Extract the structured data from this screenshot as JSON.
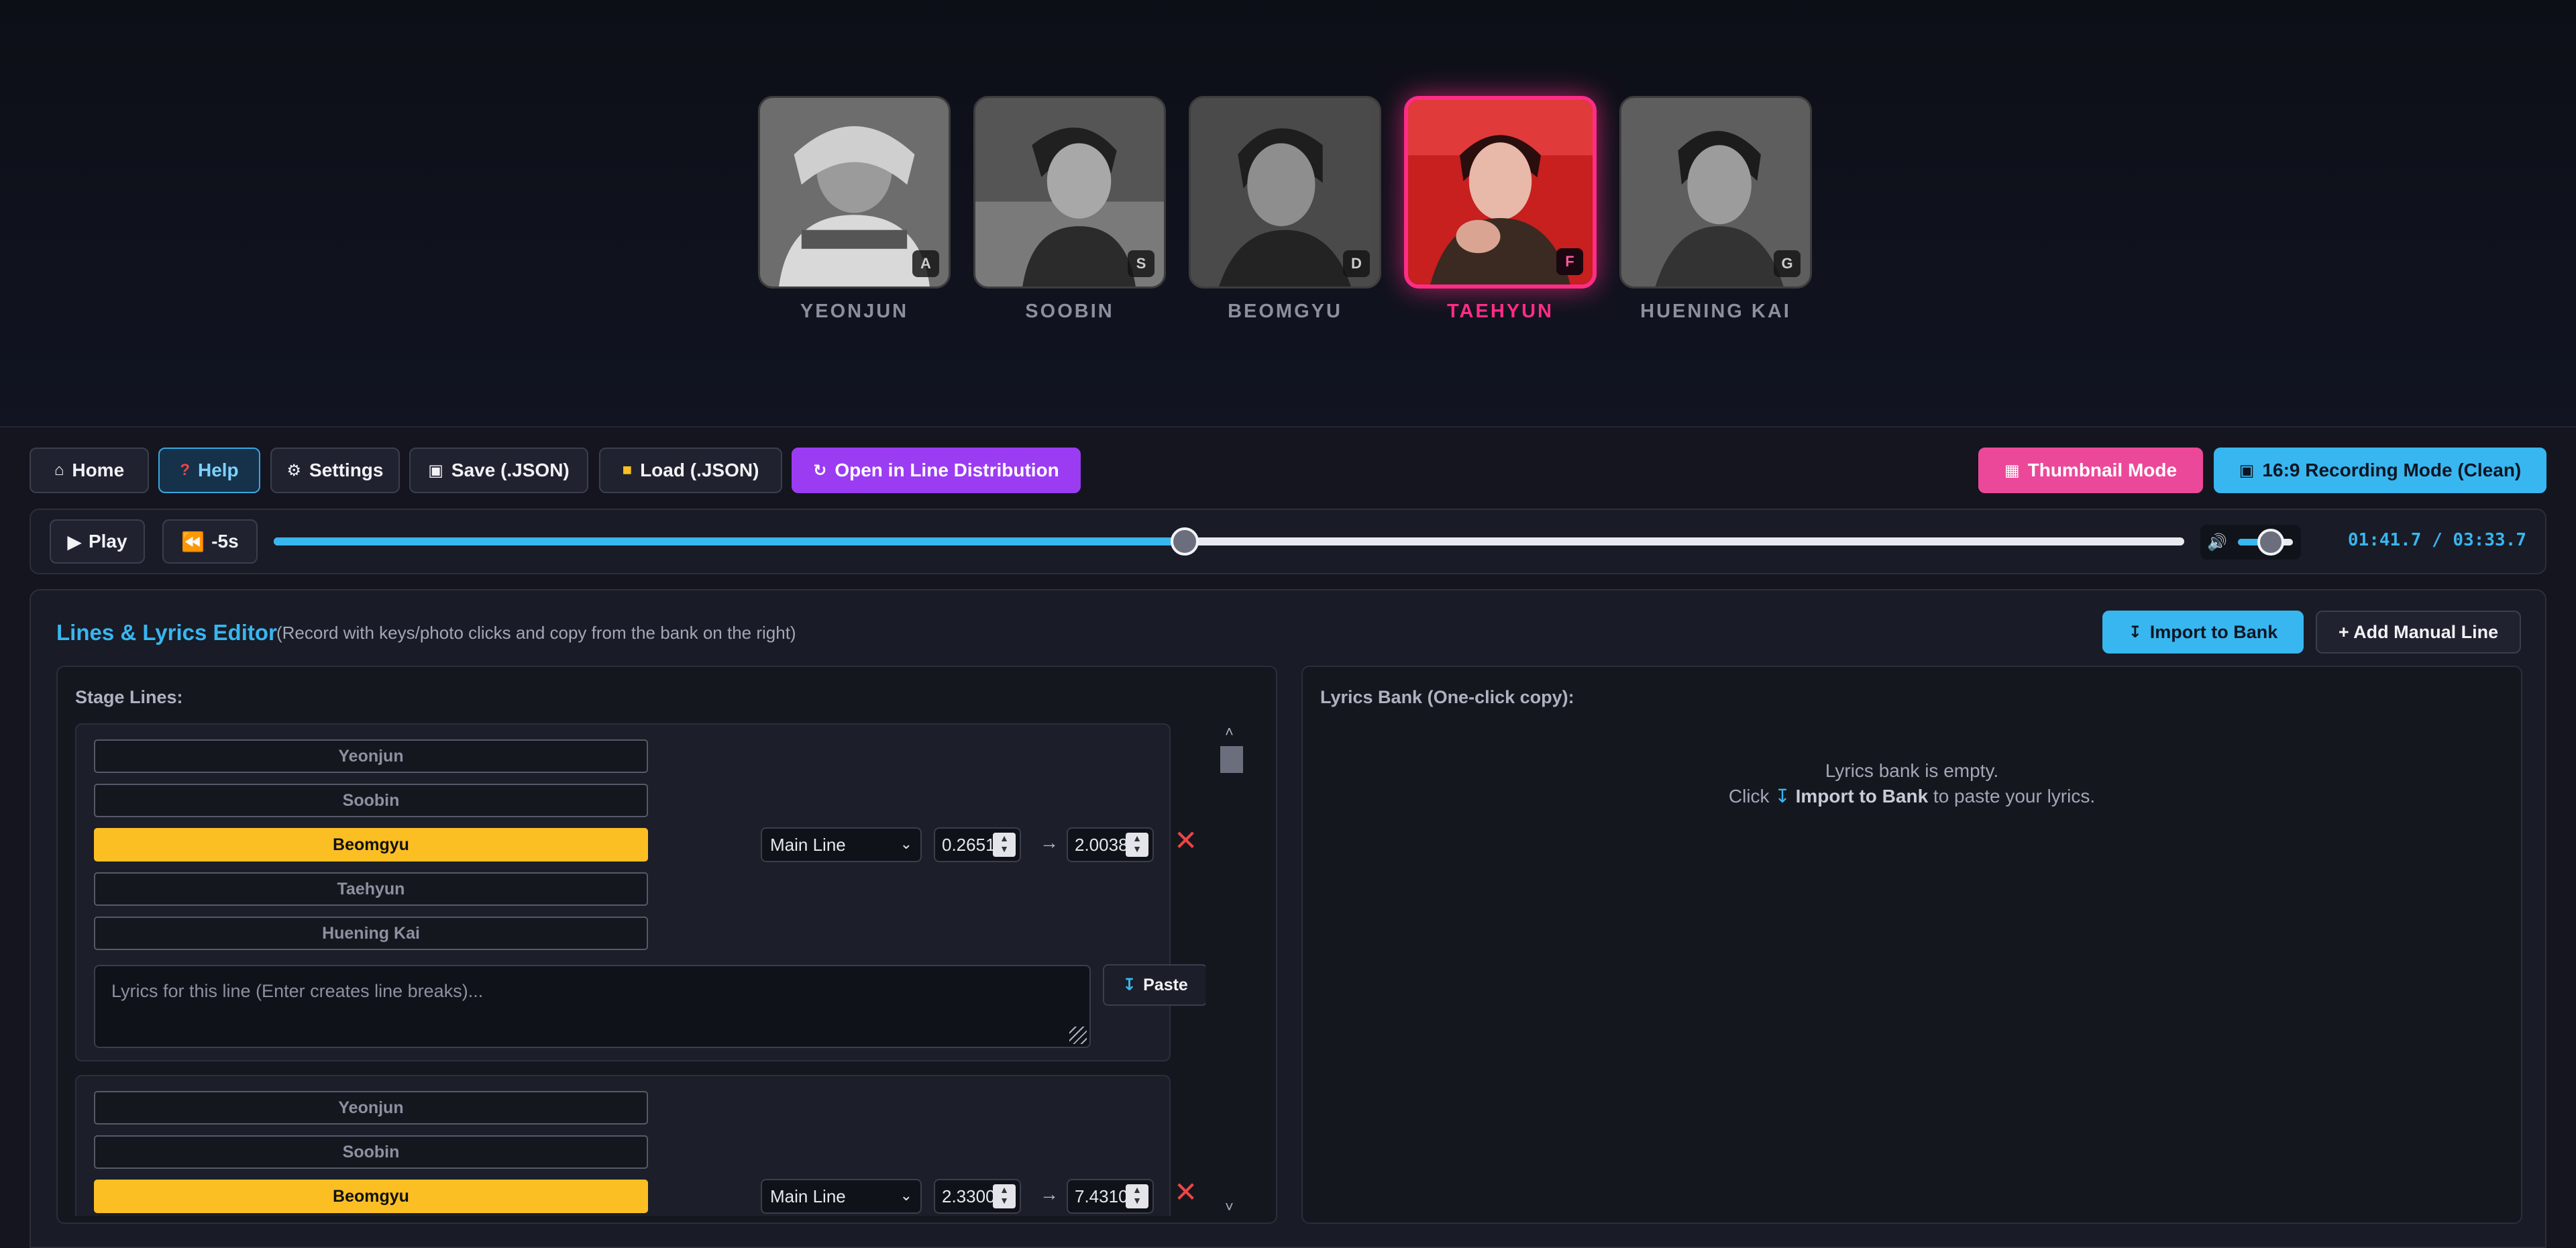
{
  "members": [
    {
      "name": "YEONJUN",
      "key": "A",
      "active": false
    },
    {
      "name": "SOOBIN",
      "key": "S",
      "active": false
    },
    {
      "name": "BEOMGYU",
      "key": "D",
      "active": false
    },
    {
      "name": "TAEHYUN",
      "key": "F",
      "active": true
    },
    {
      "name": "HUENING KAI",
      "key": "G",
      "active": false
    }
  ],
  "toolbar": {
    "home": "Home",
    "help": "Help",
    "settings": "Settings",
    "save": "Save (.JSON)",
    "load": "Load (.JSON)",
    "open_line_distribution": "Open in Line Distribution",
    "thumbnail_mode": "Thumbnail Mode",
    "recording_mode": "16:9 Recording Mode (Clean)"
  },
  "player": {
    "play": "Play",
    "rewind": "-5s",
    "progress": 0.477,
    "volume": 0.6,
    "time": "01:41.7 / 03:33.7"
  },
  "editor": {
    "title": "Lines & Lyrics Editor",
    "subtitle": "(Record with keys/photo clicks and copy from the bank on the right)",
    "import_to_bank": "Import to Bank",
    "add_manual_line": "+ Add Manual Line",
    "stage_lines_label": "Stage Lines:",
    "member_options": [
      "Yeonjun",
      "Soobin",
      "Beomgyu",
      "Taehyun",
      "Huening Kai"
    ],
    "lyrics_placeholder": "Lyrics for this line (Enter creates line breaks)...",
    "paste_label": "Paste",
    "lines": [
      {
        "selected": "Beomgyu",
        "type": "Main Line",
        "start": "0.2651",
        "end": "2.0038"
      },
      {
        "selected": "Beomgyu",
        "type": "Main Line",
        "start": "2.3300",
        "end": "7.4310"
      }
    ],
    "bank": {
      "label": "Lyrics Bank (One-click copy):",
      "empty_line1": "Lyrics bank is empty.",
      "empty_click": "Click",
      "empty_action": "Import to Bank",
      "empty_tail": "to paste your lyrics."
    }
  },
  "colors": {
    "accent_blue": "#38b6f0",
    "active_pink": "#ff2d86",
    "selected_yellow": "#fbbf24",
    "purple": "#9b3cf2",
    "remove_red": "#ef4444"
  },
  "icons": [
    "home-icon",
    "help-icon",
    "gear-icon",
    "save-icon",
    "folder-icon",
    "refresh-icon",
    "image-icon",
    "camera-icon",
    "play-icon",
    "rewind-icon",
    "volume-icon",
    "inbox-icon",
    "close-icon",
    "chevron-down-icon"
  ]
}
